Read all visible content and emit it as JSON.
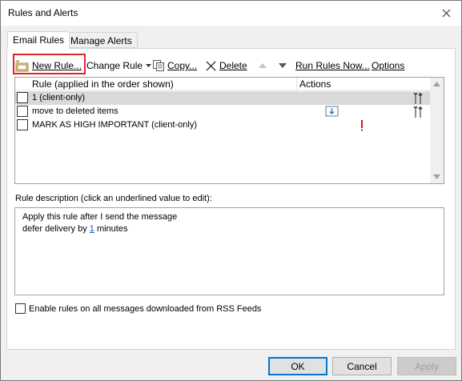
{
  "window": {
    "title": "Rules and Alerts"
  },
  "tabs": [
    {
      "label": "Email Rules",
      "active": true
    },
    {
      "label": "Manage Alerts",
      "active": false
    }
  ],
  "toolbar": {
    "new_rule": "New Rule...",
    "change_rule": "Change Rule",
    "copy": "Copy...",
    "delete": "Delete",
    "run_rules_now": "Run Rules Now...",
    "options": "Options"
  },
  "list": {
    "columns": {
      "rule": "Rule (applied in the order shown)",
      "actions": "Actions"
    },
    "rows": [
      {
        "name": "1  (client-only)",
        "checked": false,
        "selected": true,
        "action_icon": "",
        "options_icon": "wrench-icon"
      },
      {
        "name": "move to deleted items",
        "checked": false,
        "selected": false,
        "action_icon": "move-to-folder-icon",
        "options_icon": "wrench-icon"
      },
      {
        "name": "MARK AS HIGH IMPORTANT  (client-only)",
        "checked": false,
        "selected": false,
        "action_icon": "high-importance-icon",
        "options_icon": ""
      }
    ]
  },
  "description": {
    "label": "Rule description (click an underlined value to edit):",
    "line1": "Apply this rule after I send the message",
    "line2_prefix": "defer delivery by ",
    "line2_link": "1",
    "line2_suffix": " minutes"
  },
  "rss": {
    "label": "Enable rules on all messages downloaded from RSS Feeds",
    "checked": false
  },
  "buttons": {
    "ok": "OK",
    "cancel": "Cancel",
    "apply": "Apply"
  },
  "colors": {
    "highlight": "#e0252b",
    "link": "#1a4fd6",
    "importance": "#d01c1c"
  }
}
